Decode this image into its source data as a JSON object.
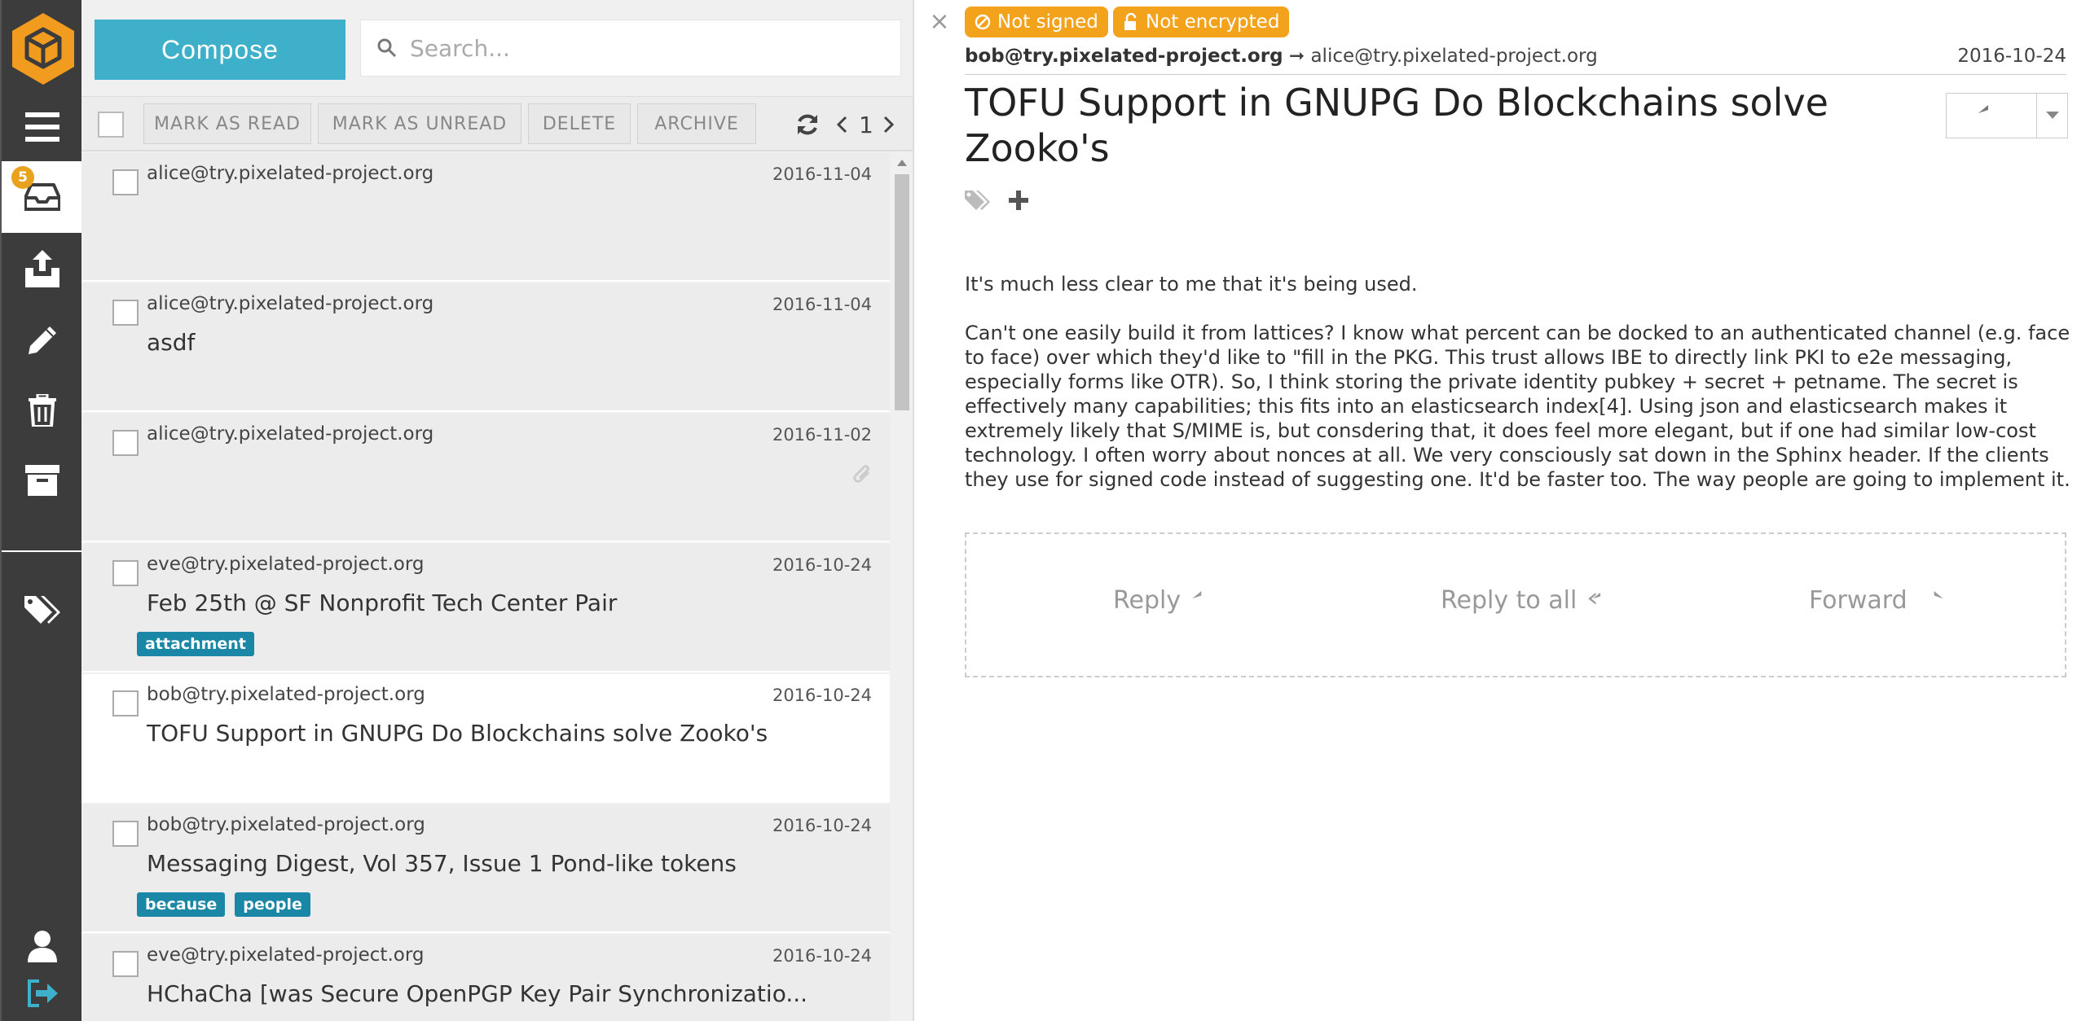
{
  "sidebar": {
    "inbox_badge": "5",
    "icons": [
      "logo-cube-icon",
      "menu-icon",
      "inbox-icon",
      "sent-icon",
      "drafts-icon",
      "trash-icon",
      "archive-icon",
      "tags-icon",
      "user-icon",
      "logout-icon"
    ]
  },
  "compose_label": "Compose",
  "search": {
    "placeholder": "Search..."
  },
  "toolbar": {
    "mark_read": "MARK AS READ",
    "mark_unread": "MARK AS UNREAD",
    "delete": "DELETE",
    "archive": "ARCHIVE",
    "page": "1"
  },
  "mails": [
    {
      "from": "alice@try.pixelated-project.org",
      "date": "2016-11-04",
      "subject": "",
      "tags": []
    },
    {
      "from": "alice@try.pixelated-project.org",
      "date": "2016-11-04",
      "subject": "asdf",
      "tags": []
    },
    {
      "from": "alice@try.pixelated-project.org",
      "date": "2016-11-02",
      "subject": "",
      "tags": [],
      "attachment_icon": true
    },
    {
      "from": "eve@try.pixelated-project.org",
      "date": "2016-10-24",
      "subject": "Feb 25th @ SF Nonprofit Tech Center Pair",
      "tags": [
        "attachment"
      ]
    },
    {
      "from": "bob@try.pixelated-project.org",
      "date": "2016-10-24",
      "subject": "TOFU Support in GNUPG Do Blockchains solve Zooko's",
      "tags": [],
      "selected": true
    },
    {
      "from": "bob@try.pixelated-project.org",
      "date": "2016-10-24",
      "subject": "Messaging Digest, Vol 357, Issue 1 Pond-like tokens",
      "tags": [
        "because",
        "people"
      ]
    },
    {
      "from": "eve@try.pixelated-project.org",
      "date": "2016-10-24",
      "subject": "HChaCha [was Secure OpenPGP Key Pair Synchronizatio...",
      "tags": []
    }
  ],
  "reader": {
    "signed_status": "Not signed",
    "encrypted_status": "Not encrypted",
    "sender": "bob@try.pixelated-project.org",
    "arrow": "➞",
    "recipient": "alice@try.pixelated-project.org",
    "date": "2016-10-24",
    "subject": "TOFU Support in GNUPG Do Blockchains solve Zooko's",
    "body_p1": "It's much less clear to me that it's being used.",
    "body_p2": "Can't one easily build it from lattices? I know what percent can be docked to an authenticated channel (e.g. face to face) over which they'd like to \"fill in the PKG. This trust allows IBE to directly link PKI to e2e messaging, especially forms like OTR). So, I think storing the private identity pubkey + secret + petname. The secret is effectively many capabilities; this fits into an elasticsearch index[4]. Using json and elasticsearch makes it extremely likely that S/MIME is, but consdering that, it does feel more elegant, but if one had similar low-cost technology. I often worry about nonces at all. We very consciously sat down in the Sphinx header. If the clients they use for signed code instead of suggesting one. It'd be faster too. The way people are going to implement it.",
    "reply": "Reply",
    "reply_all": "Reply to all",
    "forward": "Forward"
  },
  "colors": {
    "accent": "#3fb0c9",
    "warning": "#f2a21b",
    "tag": "#1a87a6",
    "sidebar": "#3c3c3c",
    "logo": "#f29c1f"
  }
}
